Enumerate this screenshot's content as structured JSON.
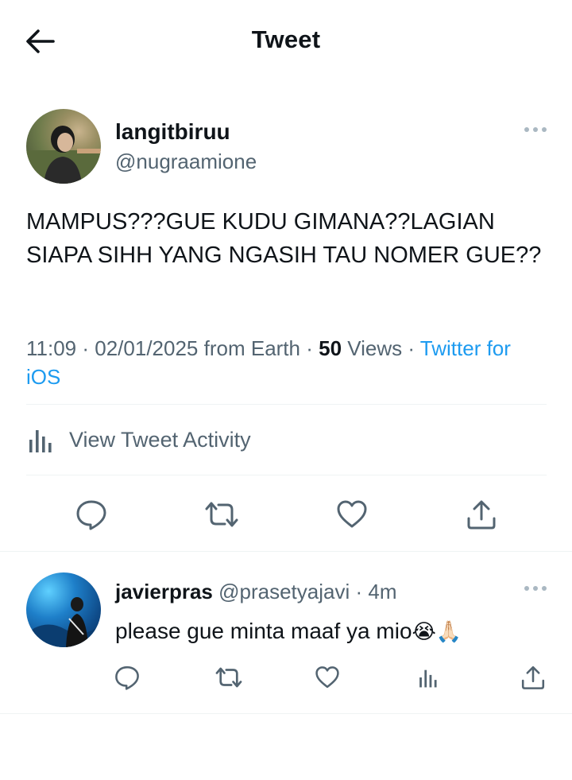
{
  "header": {
    "title": "Tweet"
  },
  "tweet": {
    "author_name": "langitbiruu",
    "author_handle": "@nugraamione",
    "text": "MAMPUS???GUE KUDU GIMANA??LAGIAN SIAPA SIHH YANG NGASIH TAU NOMER GUE??",
    "time": "11:09",
    "date": "02/01/2025",
    "from": "from Earth",
    "views_count": "50",
    "views_label": "Views",
    "client": "Twitter for iOS",
    "activity_label": "View Tweet Activity"
  },
  "reply": {
    "author_name": "javierpras",
    "author_handle": "@prasetyajavi",
    "time_ago": "4m",
    "text": "please gue minta maaf ya mio",
    "emoji": "😭🙏🏻"
  },
  "colors": {
    "accent": "#1d9bf0",
    "text": "#0f1419",
    "muted": "#536471",
    "divider": "#eff3f4"
  },
  "icons": [
    "back-arrow-icon",
    "more-icon",
    "analytics-icon",
    "reply-icon",
    "retweet-icon",
    "like-icon",
    "share-icon"
  ]
}
